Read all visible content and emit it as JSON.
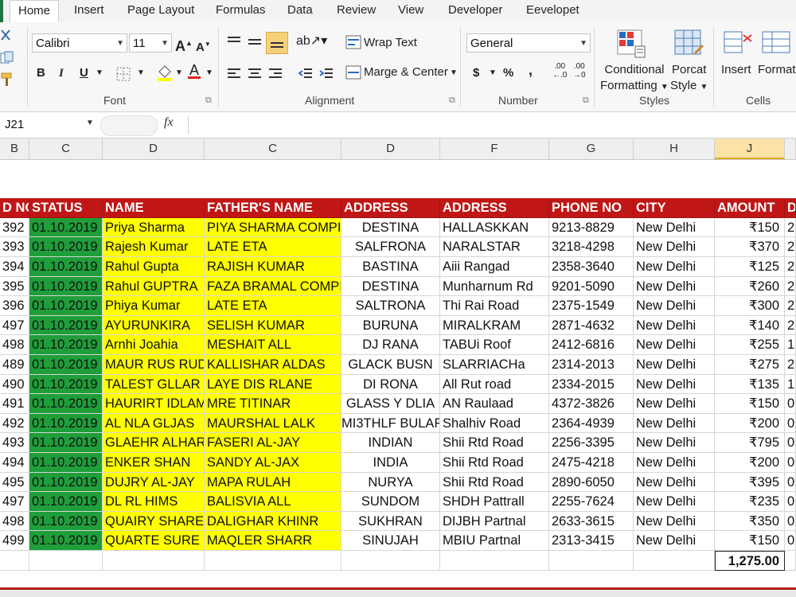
{
  "ribbon_tabs": [
    "Home",
    "Insert",
    "Page Layout",
    "Formulas",
    "Data",
    "Review",
    "View",
    "Developer",
    "Eevelopet"
  ],
  "font": {
    "name": "Calibri",
    "size": "11",
    "bold": "B",
    "italic": "I",
    "underline": "U",
    "grow": "A",
    "shrink": "A",
    "color": "A",
    "label": "Font"
  },
  "alignment": {
    "wrap_text": "Wrap Text",
    "merge_center": "Marge & Center",
    "label": "Alignment"
  },
  "number": {
    "format": "General",
    "currency": "$",
    "percent": "%",
    "comma": ",",
    "label": "Number",
    "inc_dec": ".00",
    "inc_dec2": "→0"
  },
  "styles": {
    "conditional": [
      "Conditional",
      "Formatting"
    ],
    "format_style": [
      "Porcat",
      "Style"
    ],
    "label": "Styles"
  },
  "cells": {
    "insert": "Insert",
    "format": "Format",
    "label": "Cells"
  },
  "name_box": "J21",
  "fx": "fx",
  "col_headers": [
    "B",
    "C",
    "D",
    "C",
    "D",
    "F",
    "G",
    "H",
    "J"
  ],
  "table_headers": [
    "D NO",
    "STATUS",
    "NAME",
    "FATHER'S NAME",
    "ADDRESS",
    "ADDRESS",
    "PHONE NO",
    "CITY",
    "AMOUNT",
    "D"
  ],
  "rows": [
    [
      "392",
      "01.10.2019",
      "Priya Sharma",
      "PIYA SHARMA COMPI",
      "DESTINA",
      "HALLASKKAN",
      "9213-8829",
      "New Delhi",
      "₹150",
      "2"
    ],
    [
      "393",
      "01.10.2019",
      "Rajesh Kumar",
      "LATE ETA",
      "SALFRONA",
      "NARALSTAR",
      "3218-4298",
      "New Delhi",
      "₹370",
      "2"
    ],
    [
      "394",
      "01.10.2019",
      "Rahul Gupta",
      "RAJISH KUMAR",
      "BASTINA",
      "Aiii Rangad",
      "2358-3640",
      "New Delhi",
      "₹125",
      "2"
    ],
    [
      "395",
      "01.10.2019",
      "Rahul GUPTRA",
      "FAZA BRAMAL COMPI",
      "DESTINA",
      "Munharnum Rd",
      "9201-5090",
      "New Delhi",
      "₹260",
      "2"
    ],
    [
      "396",
      "01.10.2019",
      "Phiya Kumar",
      "LATE ETA",
      "SALTRONA",
      "Thi Rai Road",
      "2375-1549",
      "New Delhi",
      "₹300",
      "2"
    ],
    [
      "497",
      "01.10.2019",
      "AYURUNKIRA",
      "SELISH KUMAR",
      "BURUNA",
      "MIRALKRAM",
      "2871-4632",
      "New Delhi",
      "₹140",
      "2"
    ],
    [
      "498",
      "01.10.2019",
      "Arnhi Joahia",
      "MESHAIT ALL",
      "DJ RANA",
      "TABUi Roof",
      "2412-6816",
      "New Delhi",
      "₹255",
      "1"
    ],
    [
      "489",
      "01.10.2019",
      "MAUR RUS RUD",
      "KALLISHAR ALDAS",
      "GLACK BUSN",
      "SLARRIACHa",
      "2314-2013",
      "New Delhi",
      "₹275",
      "2"
    ],
    [
      "490",
      "01.10.2019",
      "TALEST GLLAR",
      "LAYE DIS RLANE",
      "DI RONA",
      "All Rut road",
      "2334-2015",
      "New Delhi",
      "₹135",
      "1"
    ],
    [
      "491",
      "01.10.2019",
      "HAURIRT IDLAM",
      "MRE TITINAR",
      "GLASS Y DLIA",
      "AN Raulaad",
      "4372-3826",
      "New Delhi",
      "₹150",
      "0"
    ],
    [
      "492",
      "01.10.2019",
      "AL NLA GLJAS",
      "MAURSHAL LALK",
      "MI3THLF BULAR",
      "Shalhiv Road",
      "2364-4939",
      "New Delhi",
      "₹200",
      "0"
    ],
    [
      "493",
      "01.10.2019",
      "GLAEHR ALHAR",
      "FASERI AL-JAY",
      "INDIAN",
      "Shii Rtd Road",
      "2256-3395",
      "New Delhi",
      "₹795",
      "0"
    ],
    [
      "494",
      "01.10.2019",
      "ENKER SHAN",
      "SANDY AL-JAX",
      "INDIA",
      "Shii Rtd Road",
      "2475-4218",
      "New Delhi",
      "₹200",
      "0"
    ],
    [
      "495",
      "01.10.2019",
      "DUJRY AL-JAY",
      "MAPA RULAH",
      "NURYA",
      "Shii Rtd Road",
      "2890-6050",
      "New Delhi",
      "₹395",
      "0"
    ],
    [
      "497",
      "01.10.2019",
      "DL RL HIMS",
      "BALISVIA ALL",
      "SUNDOM",
      "SHDH Pattrall",
      "2255-7624",
      "New Delhi",
      "₹235",
      "0"
    ],
    [
      "498",
      "01.10.2019",
      "QUAIRY SHARE",
      "DALIGHAR KHINR",
      "SUKHRAN",
      "DIJBH Partnal",
      "2633-3615",
      "New Delhi",
      "₹350",
      "0"
    ],
    [
      "499",
      "01.10.2019",
      "QUARTE SURE",
      "MAQLER SHARR",
      "SINUJAH",
      "MBIU Partnal",
      "2313-3415",
      "New Delhi",
      "₹150",
      "0"
    ]
  ],
  "total": "1,275.00",
  "colors": {
    "header_red": "#c01616",
    "status_green": "#1f9e3a",
    "highlight_yellow": "#ffff00",
    "accent_green": "#217346"
  }
}
